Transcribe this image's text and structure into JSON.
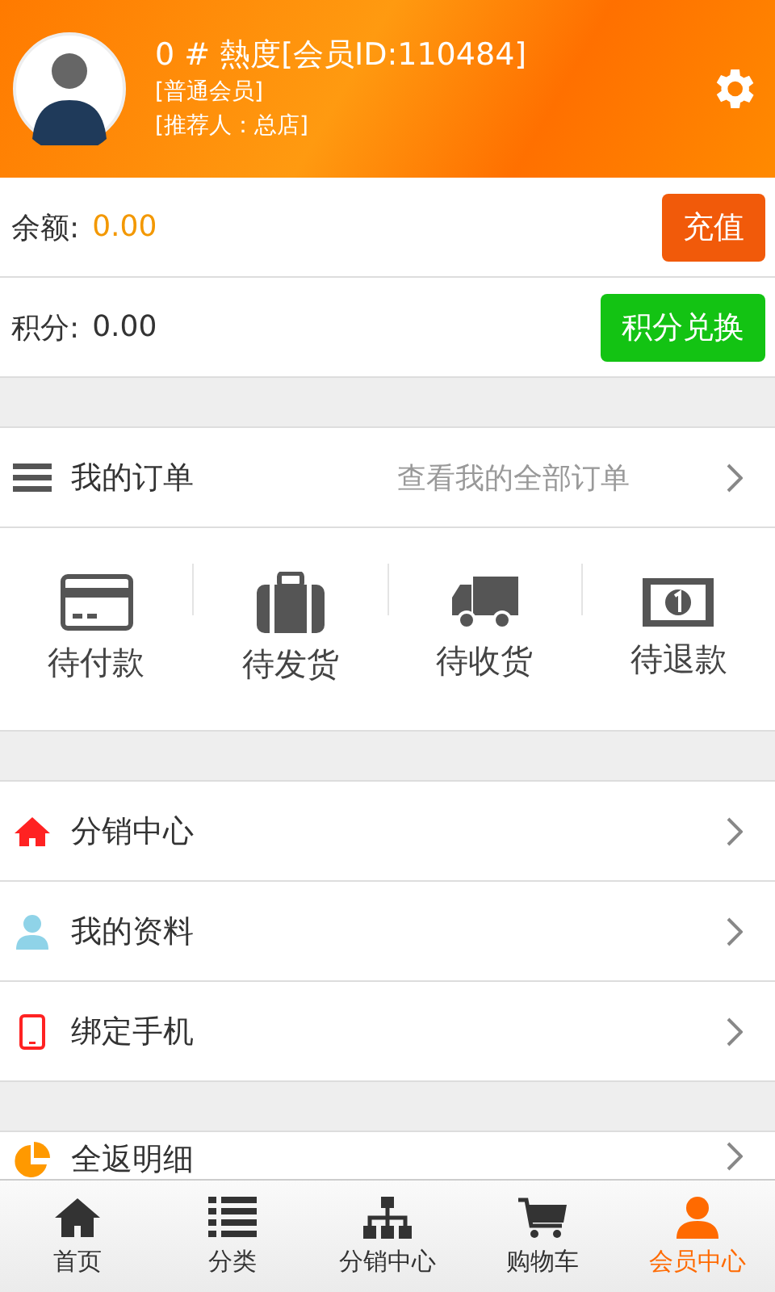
{
  "profile": {
    "name": "0 # 熱度[会员ID:110484]",
    "level": "[普通会员]",
    "referrer": "[推荐人：总店]"
  },
  "balance": {
    "label": "余额:",
    "value": "0.00",
    "button": "充值"
  },
  "points": {
    "label": "积分:",
    "value": "0.00",
    "button": "积分兑换"
  },
  "orders": {
    "title": "我的订单",
    "link": "查看我的全部订单",
    "statuses": [
      {
        "label": "待付款"
      },
      {
        "label": "待发货"
      },
      {
        "label": "待收货"
      },
      {
        "label": "待退款"
      }
    ]
  },
  "menu": [
    {
      "label": "分销中心"
    },
    {
      "label": "我的资料"
    },
    {
      "label": "绑定手机"
    }
  ],
  "menu2": [
    {
      "label": "全返明细"
    }
  ],
  "tabs": [
    {
      "label": "首页",
      "selected": false
    },
    {
      "label": "分类",
      "selected": false
    },
    {
      "label": "分销中心",
      "selected": false
    },
    {
      "label": "购物车",
      "selected": false
    },
    {
      "label": "会员中心",
      "selected": true
    }
  ]
}
